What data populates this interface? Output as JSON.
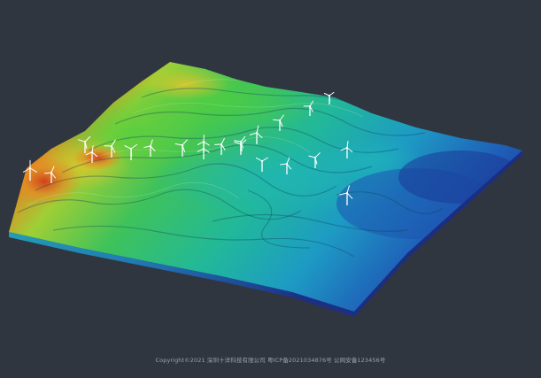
{
  "page": {
    "background_color": "#2f3640"
  },
  "scene": {
    "terrain_palette": [
      "#1a2e8c",
      "#1f5fb8",
      "#1d9bc4",
      "#21b89a",
      "#3fc25a",
      "#9fcf35",
      "#d9c22b",
      "#e08a24",
      "#c9401f"
    ],
    "turbine_icon": "wind-turbine-icon",
    "turbine_count": 22
  },
  "footer": {
    "copyright_text": "Copyright©2021 深圳十洋科技有限公司  粤ICP备2021034876号  公网安备123456号"
  }
}
